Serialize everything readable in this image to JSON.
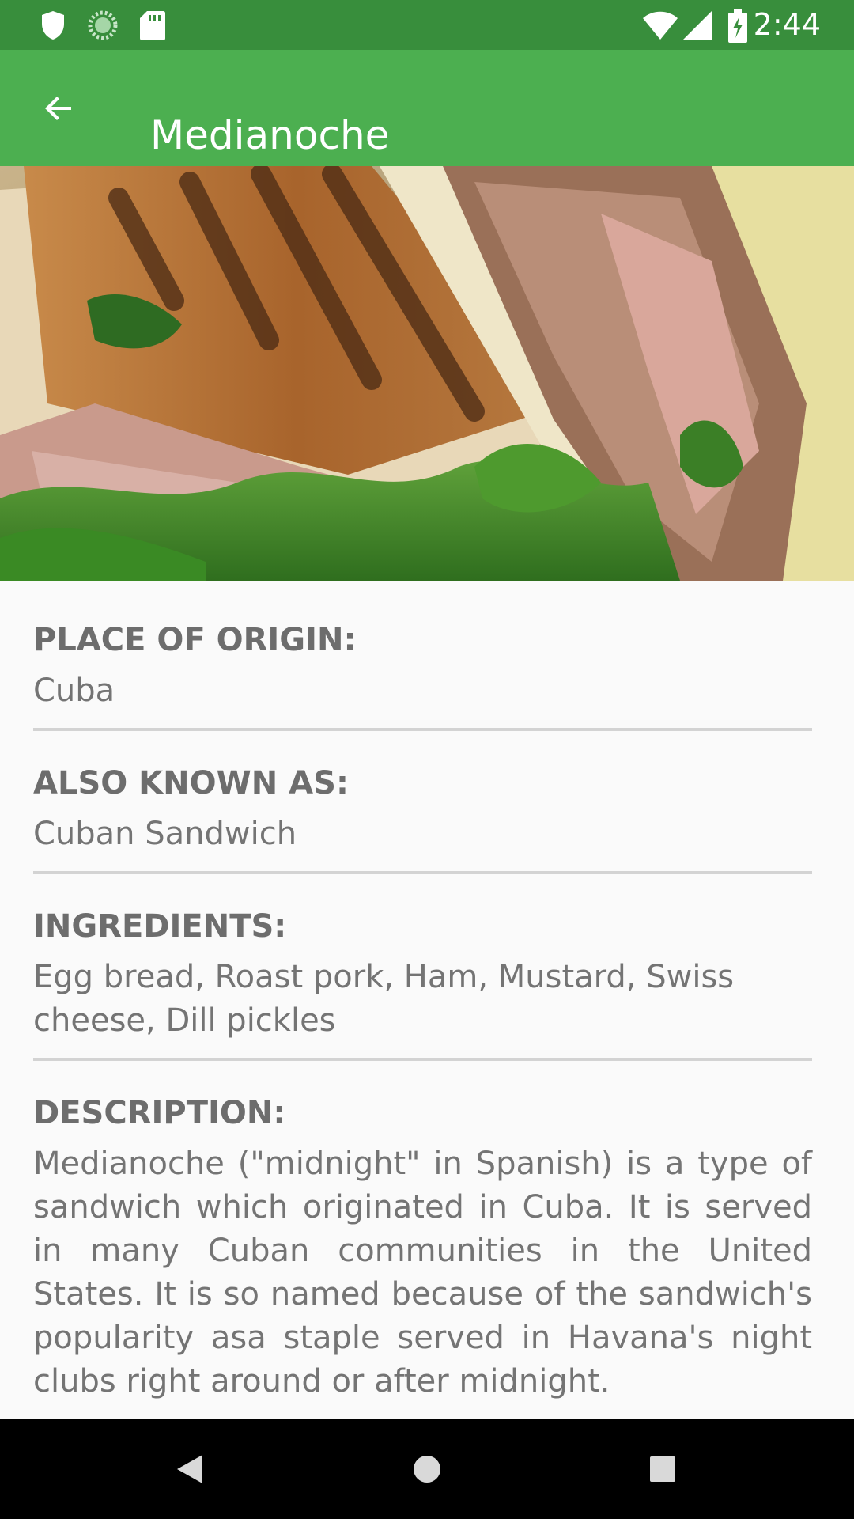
{
  "status_bar": {
    "time": "2:44",
    "icons": [
      "shield-icon",
      "sync-icon",
      "sd-card-icon",
      "wifi-icon",
      "signal-icon",
      "battery-charging-icon"
    ]
  },
  "app_bar": {
    "title": "Medianoche",
    "back_icon": "arrow-back-icon"
  },
  "hero_image": {
    "subject": "sandwich-photo"
  },
  "details": {
    "origin": {
      "label": "PLACE OF ORIGIN:",
      "value": "Cuba"
    },
    "aka": {
      "label": "ALSO KNOWN AS:",
      "value": "Cuban Sandwich"
    },
    "ingredients": {
      "label": "INGREDIENTS:",
      "value": "Egg bread, Roast pork, Ham, Mustard, Swiss cheese, Dill pickles"
    },
    "description": {
      "label": "DESCRIPTION:",
      "value": "Medianoche (\"midnight\" in Spanish) is a type of sandwich which originated in Cuba. It is served in many Cuban communities in the United States. It is so named because of the sandwich's popularity asa staple served in Havana's night clubs right around or after midnight."
    }
  },
  "nav_bar": {
    "icons": [
      "nav-back-icon",
      "nav-home-icon",
      "nav-recents-icon"
    ]
  },
  "colors": {
    "status_bar": "#388e3c",
    "app_bar": "#4caf50",
    "label_text": "#6d6d6d",
    "value_text": "#747474",
    "divider": "#d3d3d3"
  }
}
